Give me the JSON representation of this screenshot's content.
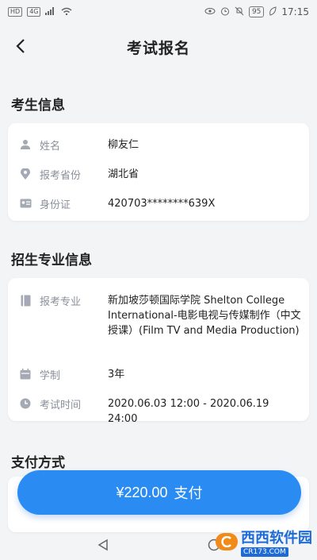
{
  "status_bar": {
    "left_icons": [
      "HD",
      "4G"
    ],
    "battery": "95",
    "time": "17:15"
  },
  "header": {
    "title": "考试报名"
  },
  "candidate_section": {
    "title": "考生信息",
    "rows": [
      {
        "icon": "person-icon",
        "label": "姓名",
        "value": "柳友仁"
      },
      {
        "icon": "location-icon",
        "label": "报考省份",
        "value": "湖北省"
      },
      {
        "icon": "id-card-icon",
        "label": "身份证",
        "value": "420703********639X"
      }
    ]
  },
  "major_section": {
    "title": "招生专业信息",
    "rows": [
      {
        "icon": "book-icon",
        "label": "报考专业",
        "value": "新加坡莎顿国际学院 Shelton College International-电影电视与传媒制作（中文授课）(Film TV and Media Production)"
      },
      {
        "icon": "calendar-icon",
        "label": "学制",
        "value": "3年"
      },
      {
        "icon": "clock-icon",
        "label": "考试时间",
        "value": "2020.06.03 12:00 - 2020.06.19 24:00"
      }
    ]
  },
  "payment_section": {
    "title": "支付方式"
  },
  "pay_button": {
    "amount": "¥220.00",
    "label": "支付"
  },
  "watermark": {
    "brand": "西西软件园",
    "site": "CR173.COM"
  },
  "colors": {
    "accent": "#2a8cf3",
    "background": "#f3f4f6",
    "label": "#8a8f99"
  }
}
